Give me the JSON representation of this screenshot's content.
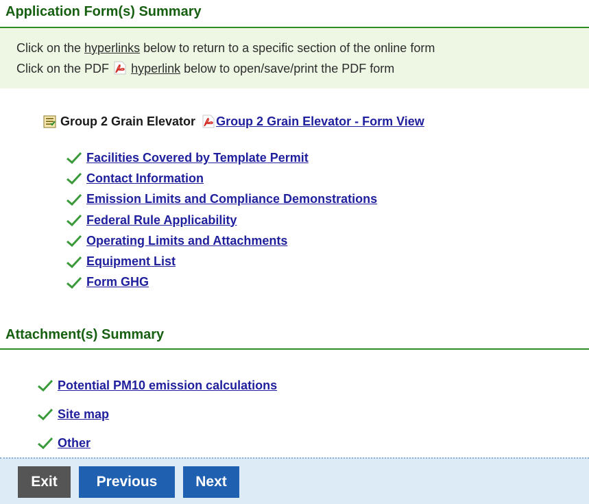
{
  "application_summary": {
    "title": "Application Form(s) Summary",
    "info_line1_pre": "Click on the ",
    "info_line1_link": "hyperlinks",
    "info_line1_post": " below to return to a specific section of the online form",
    "info_line2_pre": "Click on the PDF ",
    "info_line2_link": "hyperlink",
    "info_line2_post": " below to open/save/print the PDF form",
    "group_label": "Group 2 Grain Elevator",
    "group_pdf_link": "Group 2 Grain Elevator - Form View",
    "sections": [
      "Facilities Covered by Template Permit",
      "Contact Information",
      "Emission Limits and Compliance Demonstrations",
      "Federal Rule Applicability",
      "Operating Limits and Attachments",
      "Equipment List",
      "Form GHG"
    ]
  },
  "attachment_summary": {
    "title": "Attachment(s) Summary",
    "items": [
      "Potential PM10 emission calculations",
      "Site map",
      "Other"
    ]
  },
  "footer": {
    "exit_label": "Exit",
    "previous_label": "Previous",
    "next_label": "Next"
  },
  "colors": {
    "section_title": "#176011",
    "link": "#1f1f9e",
    "check": "#3a9a3a",
    "button_primary": "#1f60b0",
    "button_exit": "#555555"
  },
  "icons": [
    "check-icon",
    "pdf-icon",
    "document-icon"
  ]
}
